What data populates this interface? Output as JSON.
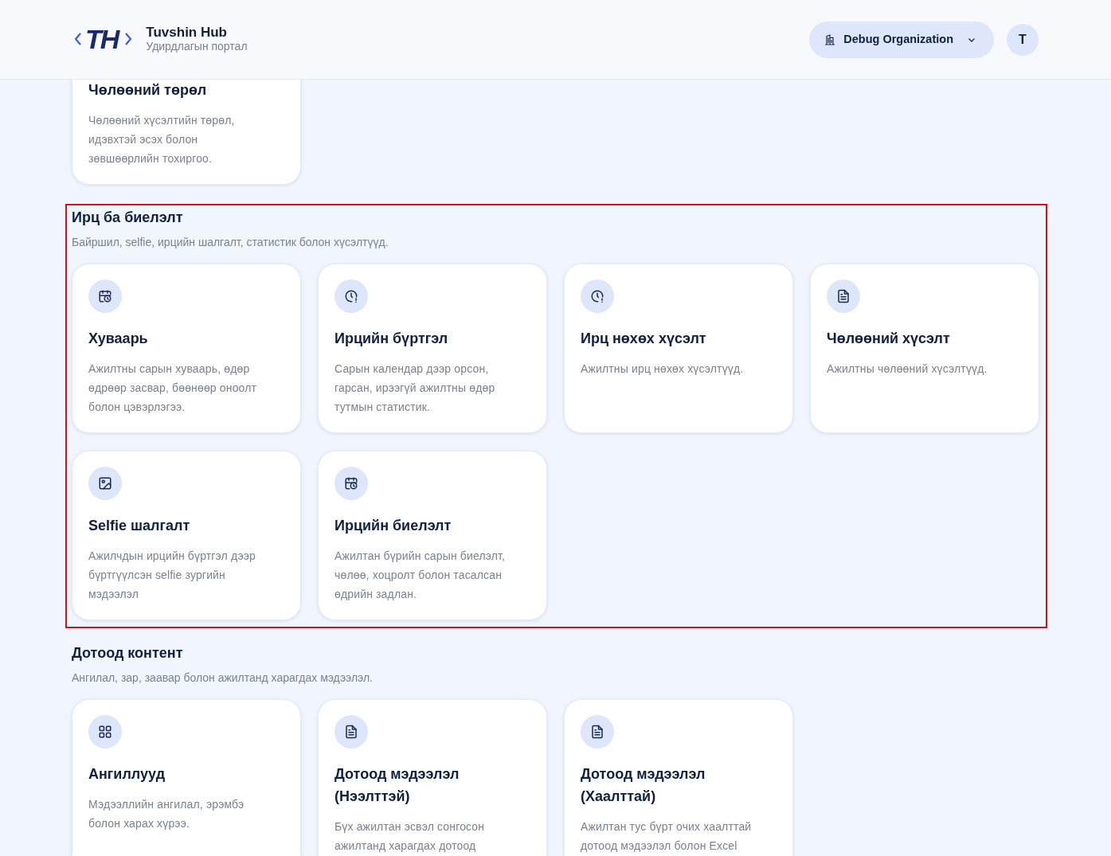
{
  "header": {
    "logo_mark": "TH",
    "app_name": "Tuvshin Hub",
    "app_subtitle": "Удирдлагын портал",
    "organization": "Debug Organization",
    "avatar": "T"
  },
  "sections": [
    {
      "highlighted": false,
      "cards": [
        {
          "kind": "none",
          "title": "Чөлөөний төрөл",
          "description": "Чөлөөний хүсэлтийн төрөл, идэвхтэй эсэх болон зөвшөөрлийн тохиргоо."
        }
      ]
    },
    {
      "title": "Ирц ба биелэлт",
      "subtitle": "Байршил, selfie, ирцийн шалгалт, статистик болон хүсэлтүүд.",
      "highlighted": true,
      "cards": [
        {
          "kind": "schedule",
          "title": "Хуваарь",
          "description": "Ажилтны сарын хуваарь, өдөр өдрөөр засвар, бөөнөөр оноолт болон цэвэрлэгээ."
        },
        {
          "kind": "clock",
          "title": "Ирцийн бүртгэл",
          "description": "Сарын календар дээр орсон, гарсан, ирээгүй ажилтны өдөр тутмын статистик."
        },
        {
          "kind": "clock",
          "title": "Ирц нөхөх хүсэлт",
          "description": "Ажилтны ирц нөхөх хүсэлтүүд."
        },
        {
          "kind": "document",
          "title": "Чөлөөний хүсэлт",
          "description": "Ажилтны чөлөөний хүсэлтүүд."
        },
        {
          "kind": "image",
          "title": "Selfie шалгалт",
          "description": "Ажилчдын ирцийн бүртгэл дээр бүртгүүлсэн selfie зургийн мэдээлэл"
        },
        {
          "kind": "schedule",
          "title": "Ирцийн биелэлт",
          "description": "Ажилтан бүрийн сарын биелэлт, чөлөө, хоцролт болон тасалсан өдрийн задлан."
        }
      ]
    },
    {
      "title": "Дотоод контент",
      "subtitle": "Ангилал, зар, заавар болон ажилтанд харагдах мэдээлэл.",
      "highlighted": false,
      "cards": [
        {
          "kind": "grid",
          "title": "Ангиллууд",
          "description": "Мэдээллийн ангилал, эрэмбэ болон харах хүрээ."
        },
        {
          "kind": "document",
          "title": "Дотоод мэдээлэл (Нээлттэй)",
          "description": "Бүх ажилтан эсвэл сонгосон ажилтанд харагдах дотоод"
        },
        {
          "kind": "document",
          "title": "Дотоод мэдээлэл (Хаалттай)",
          "description": "Ажилтан тус бүрт очих хаалттай дотоод мэдээлэл болон Excel"
        }
      ]
    }
  ]
}
